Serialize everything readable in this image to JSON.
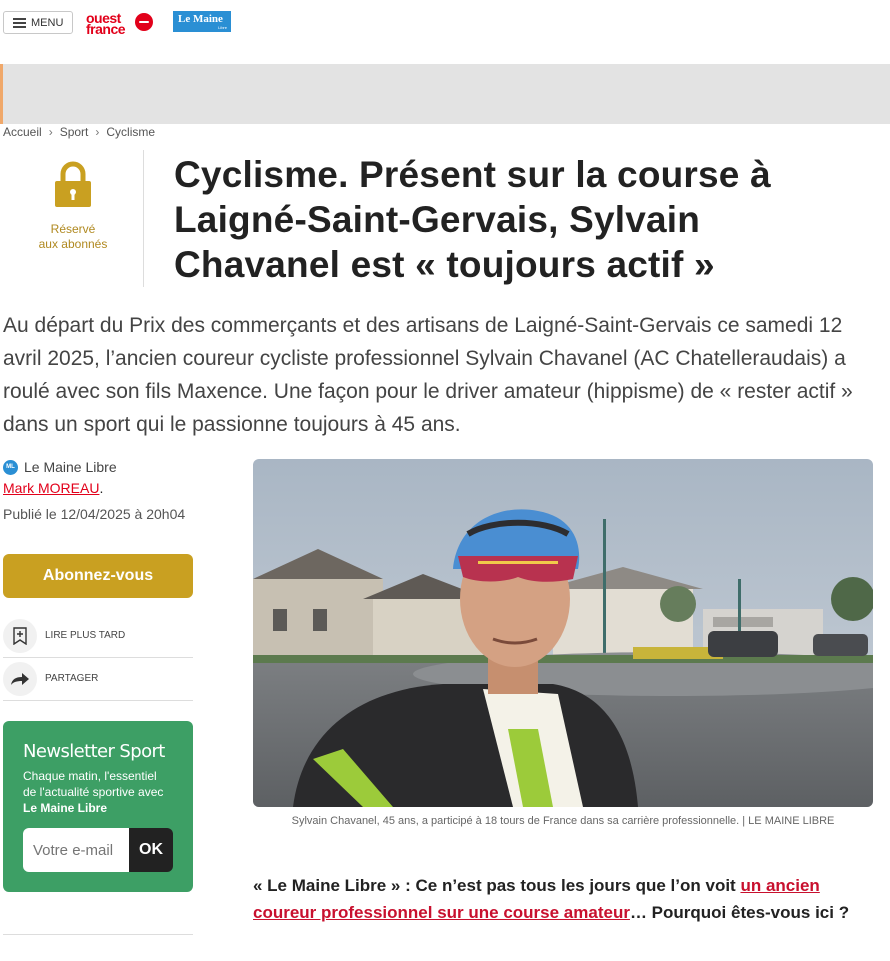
{
  "header": {
    "menu_label": "MENU",
    "logo_ouest_line1": "ouest",
    "logo_ouest_line2": "france",
    "logo_lemaine": "Le Maine",
    "logo_lemaine_sub": "Libre"
  },
  "breadcrumb": [
    "Accueil",
    "Sport",
    "Cyclisme"
  ],
  "breadcrumb_sep": "›",
  "badge": {
    "line1": "Réservé",
    "line2": "aux abonnés",
    "color": "#c9a021"
  },
  "article": {
    "title": "Cyclisme. Présent sur la course à Laigné-Saint-Gervais, Sylvain Chavanel est « toujours actif »",
    "lead": "Au départ du Prix des commerçants et des artisans de Laigné-Saint-Gervais ce samedi 12 avril 2025, l’ancien coureur cycliste professionnel Sylvain Chavanel (AC Chatelleraudais) a roulé avec son fils Maxence. Une façon pour le driver amateur (hippisme) de « rester actif » dans un sport qui le passionne toujours à 45 ans.",
    "source_badge": "ML",
    "source": "Le Maine Libre",
    "author": "Mark MOREAU",
    "author_suffix": ".",
    "published": "Publié le 12/04/2025 à 20h04",
    "photo_caption": "Sylvain Chavanel, 45 ans, a participé à 18 tours de France dans sa carrière professionnelle. | LE MAINE LIBRE",
    "question_prefix": "« Le Maine Libre » : Ce n’est pas tous les jours que l’on voit ",
    "question_link": "un ancien coureur professionnel sur une course amateur",
    "question_suffix": "… Pourquoi êtes-vous ici ?"
  },
  "sidebar": {
    "subscribe_label": "Abonnez-vous",
    "read_later_label": "LIRE PLUS TARD",
    "share_label": "PARTAGER",
    "newsletter": {
      "title": "Newsletter Sport",
      "desc_line": "Chaque matin, l'essentiel de l'actualité sportive avec",
      "desc_bold": "Le Maine Libre",
      "input_placeholder": "Votre e-mail",
      "submit_label": "OK",
      "color": "#3d9f65"
    }
  },
  "colors": {
    "brand_red": "#e2001a",
    "gold": "#c9a021",
    "link_red": "#c8102e"
  }
}
